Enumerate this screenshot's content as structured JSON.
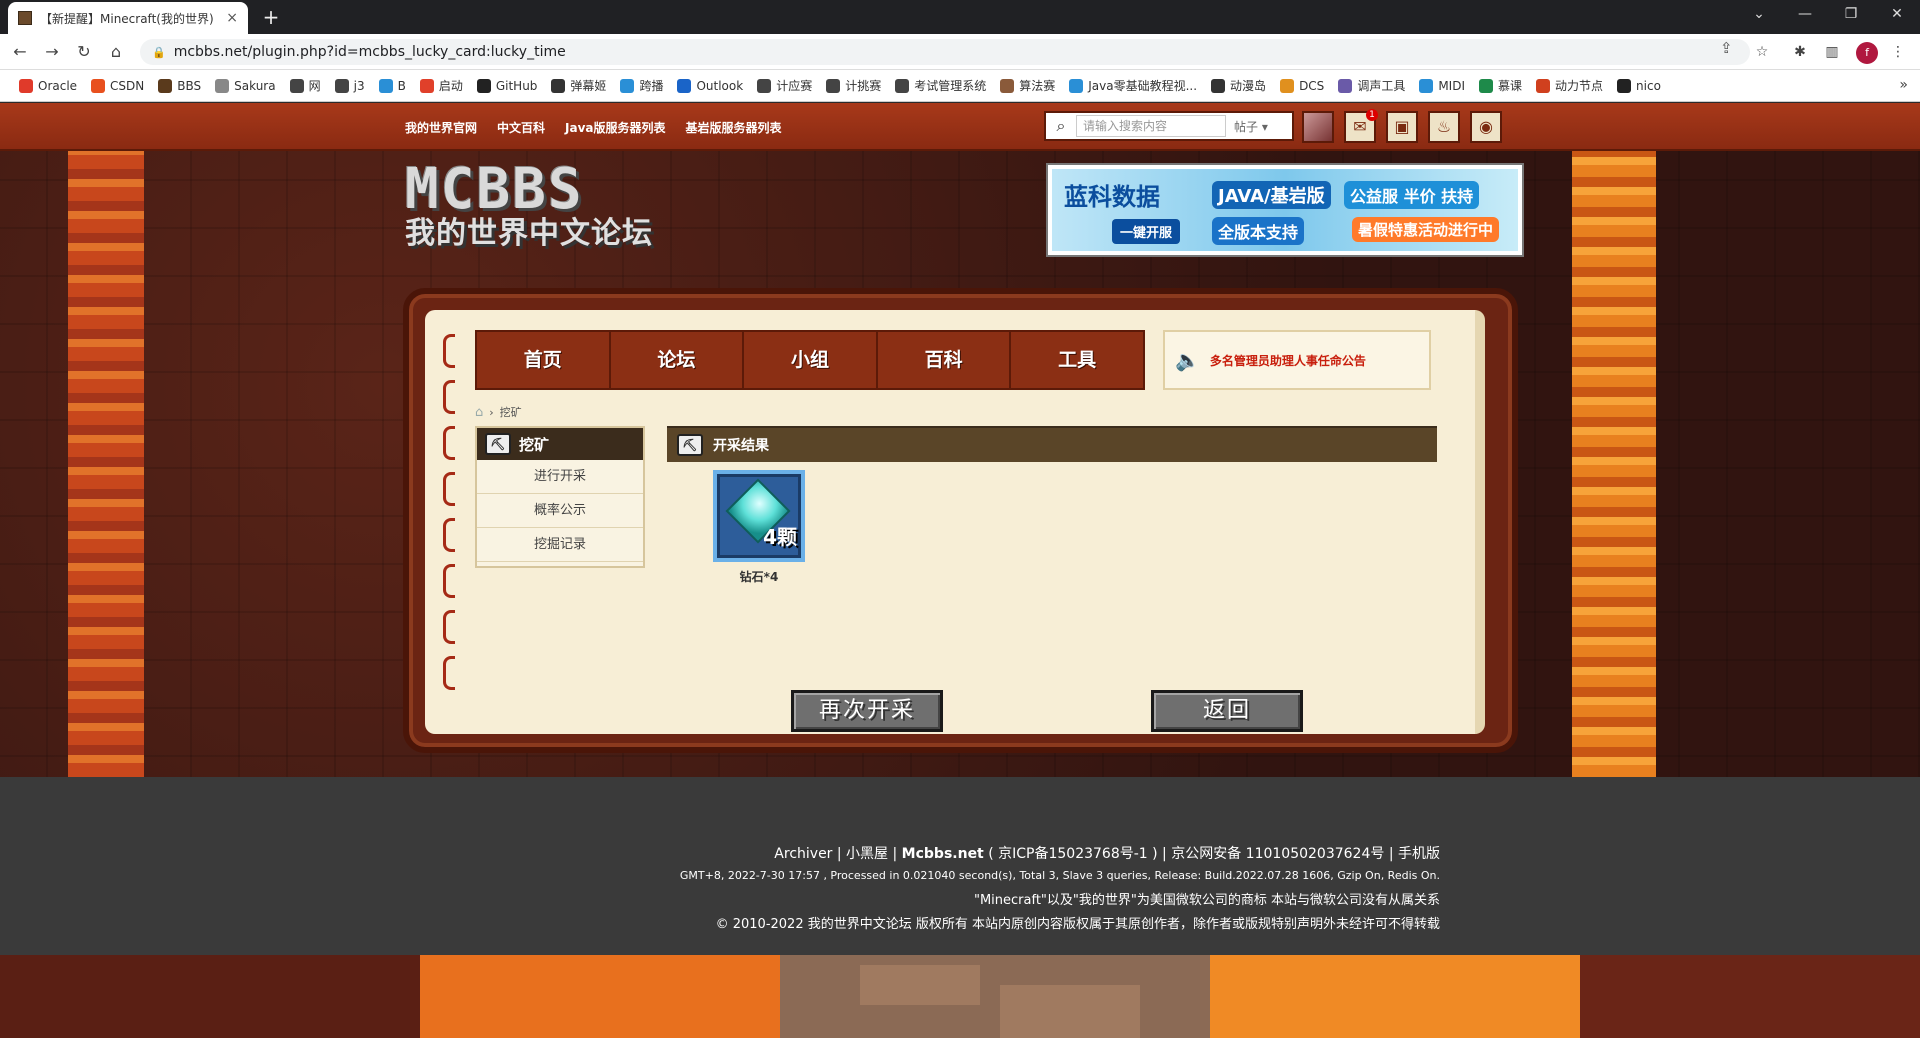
{
  "browser": {
    "tab_title": "【新提醒】Minecraft(我的世界)",
    "tab_close": "×",
    "new_tab": "+",
    "url": "mcbbs.net/plugin.php?id=mcbbs_lucky_card:lucky_time",
    "profile_letter": "f",
    "bookmarks": [
      {
        "label": "Oracle",
        "color": "#e03a2a"
      },
      {
        "label": "CSDN",
        "color": "#e8501e"
      },
      {
        "label": "BBS",
        "color": "#5a3a1c"
      },
      {
        "label": "Sakura",
        "color": "#888888"
      },
      {
        "label": "网",
        "color": "#444444"
      },
      {
        "label": "j3",
        "color": "#444444"
      },
      {
        "label": "B",
        "color": "#2a8fd6"
      },
      {
        "label": "启动",
        "color": "#e0402a"
      },
      {
        "label": "GitHub",
        "color": "#222222"
      },
      {
        "label": "弹幕姬",
        "color": "#333333"
      },
      {
        "label": "跨播",
        "color": "#2a8fd6"
      },
      {
        "label": "Outlook",
        "color": "#1a64c8"
      },
      {
        "label": "计应赛",
        "color": "#444444"
      },
      {
        "label": "计挑赛",
        "color": "#444444"
      },
      {
        "label": "考试管理系统",
        "color": "#444444"
      },
      {
        "label": "算法赛",
        "color": "#8a5a3a"
      },
      {
        "label": "Java零基础教程视...",
        "color": "#2a8fd6"
      },
      {
        "label": "动漫岛",
        "color": "#333333"
      },
      {
        "label": "DCS",
        "color": "#e0901e"
      },
      {
        "label": "调声工具",
        "color": "#6a5aa8"
      },
      {
        "label": "MIDI",
        "color": "#2a8fd6"
      },
      {
        "label": "慕课",
        "color": "#1e8a4a"
      },
      {
        "label": "动力节点",
        "color": "#d0401e"
      },
      {
        "label": "nico",
        "color": "#222222"
      }
    ],
    "bookmarks_more": "»"
  },
  "site": {
    "top_links": [
      "我的世界官网",
      "中文百科",
      "Java版服务器列表",
      "基岩版服务器列表"
    ],
    "search_placeholder": "请输入搜索内容",
    "search_type": "帖子",
    "notification_count": "1",
    "logo_line1": "MCBBS",
    "logo_line2": "我的世界中文论坛",
    "banner": {
      "brand": "蓝科数据",
      "tag1": "JAVA/基岩版",
      "tag2": "公益服 半价 扶持",
      "tag3": "一键开服",
      "tag4": "全版本支持",
      "tag5": "暑假特惠活动进行中"
    },
    "main_nav": [
      "首页",
      "论坛",
      "小组",
      "百科",
      "工具"
    ],
    "notice": "多名管理员助理人事任命公告",
    "breadcrumb": "挖矿",
    "sidebar": {
      "title": "挖矿",
      "items": [
        "进行开采",
        "概率公示",
        "挖掘记录"
      ]
    },
    "results_title": "开采结果",
    "result_item": {
      "quantity": "4颗",
      "label": "钻石*4"
    },
    "buttons": {
      "again": "再次开采",
      "back": "返回"
    },
    "footer": {
      "line1_prefix": "Archiver | 小黑屋 | ",
      "line1_site": "Mcbbs.net",
      "line1_suffix": " ( 京ICP备15023768号-1 ) | 京公网安备 11010502037624号 | 手机版",
      "line2": "GMT+8, 2022-7-30 17:57 , Processed in 0.021040 second(s), Total 3, Slave 3 queries, Release: Build.2022.07.28 1606, Gzip On, Redis On.",
      "line3": "\"Minecraft\"以及\"我的世界\"为美国微软公司的商标 本站与微软公司没有从属关系",
      "line4": "© 2010-2022 我的世界中文论坛 版权所有 本站内原创内容版权属于其原创作者，除作者或版规特别声明外未经许可不得转载"
    }
  }
}
